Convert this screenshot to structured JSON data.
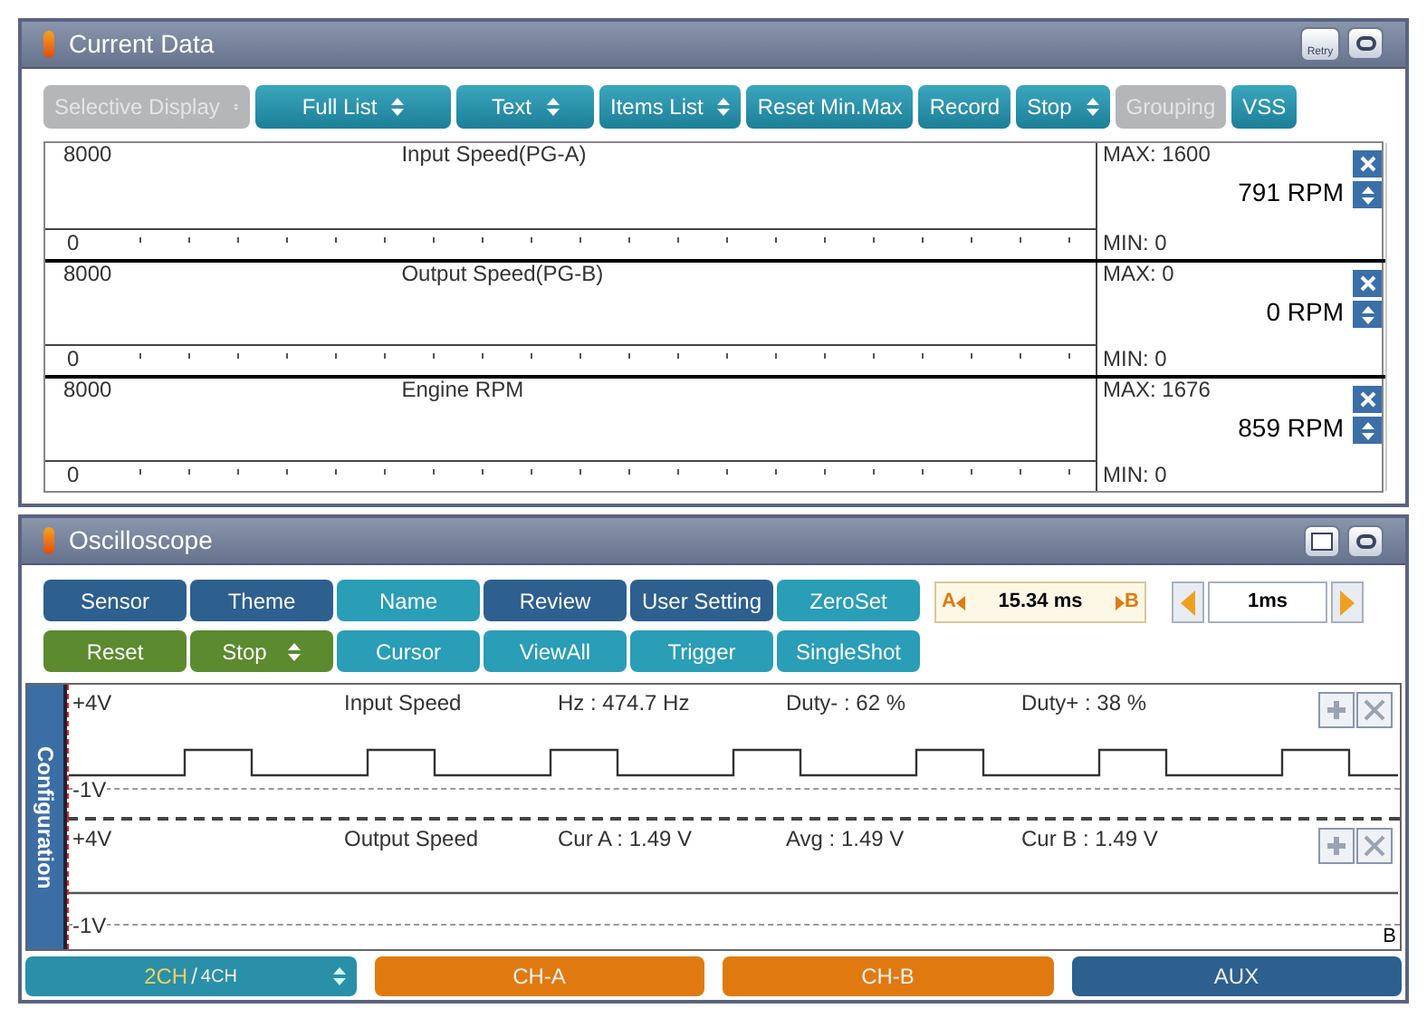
{
  "current_data": {
    "title": "Current Data",
    "retry_label": "Retry",
    "toolbar": [
      {
        "label": "Selective Display",
        "kind": "dropdown",
        "disabled": true
      },
      {
        "label": "Full List",
        "kind": "dropdown",
        "disabled": false
      },
      {
        "label": "Text",
        "kind": "dropdown",
        "disabled": false
      },
      {
        "label": "Items List",
        "kind": "dropdown",
        "disabled": false
      },
      {
        "label": "Reset Min.Max",
        "kind": "button",
        "disabled": false
      },
      {
        "label": "Record",
        "kind": "button",
        "disabled": false
      },
      {
        "label": "Stop",
        "kind": "dropdown",
        "disabled": false
      },
      {
        "label": "Grouping",
        "kind": "button",
        "disabled": true
      },
      {
        "label": "VSS",
        "kind": "button",
        "disabled": false
      }
    ],
    "strips": [
      {
        "title": "Input Speed(PG-A)",
        "scale_max": "8000",
        "scale_min": "0",
        "max": "MAX: 1600",
        "value": "791 RPM",
        "min": "MIN: 0"
      },
      {
        "title": "Output Speed(PG-B)",
        "scale_max": "8000",
        "scale_min": "0",
        "max": "MAX: 0",
        "value": "0 RPM",
        "min": "MIN: 0"
      },
      {
        "title": "Engine RPM",
        "scale_max": "8000",
        "scale_min": "0",
        "max": "MAX: 1676",
        "value": "859 RPM",
        "min": "MIN: 0"
      }
    ]
  },
  "oscilloscope": {
    "title": "Oscilloscope",
    "button_rows": [
      [
        {
          "label": "Sensor",
          "color": "#2d5f8f",
          "kind": "button"
        },
        {
          "label": "Theme",
          "color": "#2d5f8f",
          "kind": "button"
        },
        {
          "label": "Name",
          "color": "#2a9db7",
          "kind": "button"
        },
        {
          "label": "Review",
          "color": "#2d5f8f",
          "kind": "button"
        },
        {
          "label": "User Setting",
          "color": "#2d5f8f",
          "kind": "button"
        },
        {
          "label": "ZeroSet",
          "color": "#2a9db7",
          "kind": "button"
        }
      ],
      [
        {
          "label": "Reset",
          "color": "#5b8a2f",
          "kind": "button"
        },
        {
          "label": "Stop",
          "color": "#5b8a2f",
          "kind": "dropdown"
        },
        {
          "label": "Cursor",
          "color": "#2a9db7",
          "kind": "button"
        },
        {
          "label": "ViewAll",
          "color": "#2a9db7",
          "kind": "button"
        },
        {
          "label": "Trigger",
          "color": "#2a9db7",
          "kind": "button"
        },
        {
          "label": "SingleShot",
          "color": "#2a9db7",
          "kind": "button"
        }
      ]
    ],
    "cursor": {
      "a": "A",
      "value": "15.34 ms",
      "b": "B"
    },
    "time_div": "1ms",
    "side_tab": "Configuration",
    "channels": [
      {
        "name": "Input Speed",
        "top": "+4V",
        "bottom": "-1V",
        "readouts": [
          "Hz : 474.7 Hz",
          "Duty- : 62 %",
          "Duty+ : 38 %"
        ],
        "kind": "square"
      },
      {
        "name": "Output Speed",
        "top": "+4V",
        "bottom": "-1V",
        "readouts": [
          "Cur A : 1.49 V",
          "Avg : 1.49 V",
          "Cur B : 1.49 V"
        ],
        "kind": "flat",
        "marker": "B"
      }
    ],
    "bottom_tabs": [
      {
        "label": "2CH",
        "separator": "/",
        "option": "4CH",
        "color": "#2a8fa8",
        "kind": "dropdown"
      },
      {
        "label": "CH-A",
        "color": "#e07a10",
        "kind": "tab"
      },
      {
        "label": "CH-B",
        "color": "#e07a10",
        "kind": "tab"
      },
      {
        "label": "AUX",
        "color": "#2d5f8f",
        "kind": "tab"
      }
    ]
  }
}
